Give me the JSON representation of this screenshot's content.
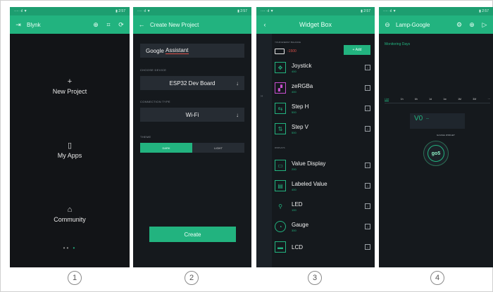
{
  "colors": {
    "accent": "#22b37f",
    "background": "#15191d",
    "error": "#e0524a"
  },
  "status_bar": {
    "left": "···· ·ıl ▼",
    "right": "▮ 2:57"
  },
  "screen1": {
    "app_title": "Blynk",
    "icons": [
      "exit-icon",
      "plus-circle-icon",
      "qr-icon",
      "sync-icon"
    ],
    "menu": [
      {
        "icon": "plus-icon",
        "label": "New Project"
      },
      {
        "icon": "phone-icon",
        "label": "My Apps"
      },
      {
        "icon": "community-icon",
        "label": "Community"
      }
    ],
    "pager": "•••"
  },
  "screen2": {
    "title": "Create New Project",
    "project_name": "Google Assistant",
    "project_name_first": "Google",
    "project_name_second": "Assistant",
    "device_caption": "CHOOSE DEVICE",
    "device_value": "ESP32 Dev Board",
    "connection_caption": "CONNECTION TYPE",
    "connection_value": "Wi-Fi",
    "theme_caption": "THEME",
    "theme_options": [
      "DARK",
      "LIGHT"
    ],
    "create_label": "Create"
  },
  "screen3": {
    "title": "Widget Box",
    "energy_caption": "YOUR ENERGY BALANCE",
    "energy_value": "-1500",
    "add_label": "+ Add",
    "controllers_caption": "CONTROLLERS",
    "displays_caption": "DISPLAYS",
    "controllers": [
      {
        "name": "Joystick",
        "cost": "400",
        "icon": "joystick-icon"
      },
      {
        "name": "zeRGBa",
        "cost": "400",
        "icon": "rgb-icon"
      },
      {
        "name": "Step H",
        "cost": "500",
        "icon": "step-h-icon"
      },
      {
        "name": "Step V",
        "cost": "500",
        "icon": "step-v-icon"
      }
    ],
    "displays": [
      {
        "name": "Value Display",
        "cost": "200",
        "icon": "value-display-icon"
      },
      {
        "name": "Labeled Value",
        "cost": "400",
        "icon": "labeled-value-icon"
      },
      {
        "name": "LED",
        "cost": "100",
        "icon": "led-icon"
      },
      {
        "name": "Gauge",
        "cost": "300",
        "icon": "gauge-icon"
      },
      {
        "name": "LCD",
        "cost": "",
        "icon": "lcd-icon"
      }
    ]
  },
  "screen4": {
    "title": "Lamp-Google",
    "monitoring_label": "Monitoring Days",
    "time_ranges": [
      "Live",
      "1h",
      "6h",
      "1d",
      "1w",
      "1M",
      "3M",
      "···"
    ],
    "value_label": "V0",
    "value_text": "--",
    "gauge_caption": "GAUGE WIDGET",
    "gauge_value": "go5"
  },
  "steps": [
    "1",
    "2",
    "3",
    "4"
  ]
}
